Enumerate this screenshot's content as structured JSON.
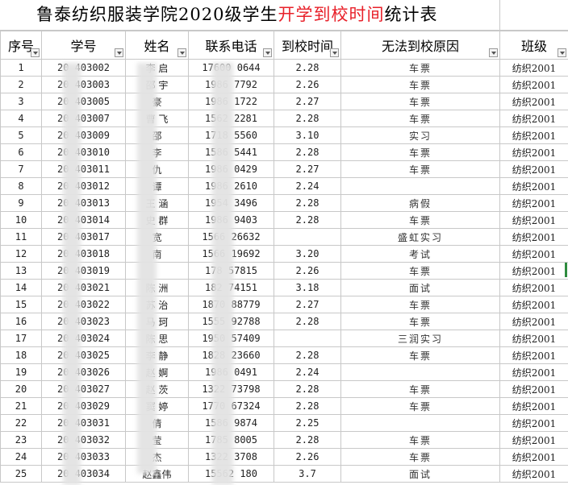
{
  "title": {
    "prefix": "鲁泰纺织服装学院2020级学生",
    "highlight": "开学到校时间",
    "suffix": "统计表"
  },
  "headers": [
    "序号",
    "学号",
    "姓名",
    "联系电话",
    "到校时间",
    "无法到校原因",
    "班级"
  ],
  "rows": [
    [
      "1",
      "20  403002",
      "李  启",
      "17600  0644",
      "2.28",
      "车票",
      "纺织2001"
    ],
    [
      "2",
      "20  403003",
      "邵  宇",
      "1986  7792",
      "2.26",
      "车票",
      "纺织2001"
    ],
    [
      "3",
      "20  403005",
      "  豪",
      "1986  1722",
      "2.27",
      "车票",
      "纺织2001"
    ],
    [
      "4",
      "20  403007",
      "曹  飞",
      "1562  2281",
      "2.28",
      "车票",
      "纺织2001"
    ],
    [
      "5",
      "20  403009",
      "邵  ",
      "1718  5560",
      "3.10",
      "实习",
      "纺织2001"
    ],
    [
      "6",
      "20  403010",
      "李  ",
      "1586  5441",
      "2.28",
      "车票",
      "纺织2001"
    ],
    [
      "7",
      "20  403011",
      "仇  ",
      "1986  0429",
      "2.27",
      "车票",
      "纺织2001"
    ],
    [
      "8",
      "20  403012",
      "谭  ",
      "1986  2610",
      "2.24",
      "",
      "纺织2001"
    ],
    [
      "9",
      "20  403013",
      "王  涵",
      "1954  3496",
      "2.28",
      "病假",
      "纺织2001"
    ],
    [
      "10",
      "20  403014",
      "史  群",
      "1986  9403",
      "2.28",
      "车票",
      "纺织2001"
    ],
    [
      "11",
      "20  403017",
      "  宽",
      "1566  26632",
      "",
      "盛虹实习",
      "纺织2001"
    ],
    [
      "12",
      "20  403018",
      "  南",
      "1566  19692",
      "3.20",
      "考试",
      "纺织2001"
    ],
    [
      "13",
      "20  403019",
      "  ",
      "178  57815",
      "2.26",
      "车票",
      "纺织2001"
    ],
    [
      "14",
      "20  403021",
      "陈  洲",
      "182  74151",
      "3.18",
      "面试",
      "纺织2001"
    ],
    [
      "15",
      "20  403022",
      "苏  治",
      "1870  88779",
      "2.27",
      "车票",
      "纺织2001"
    ],
    [
      "16",
      "20  403023",
      "马  珂",
      "1555  92788",
      "2.28",
      "车票",
      "纺织2001"
    ],
    [
      "17",
      "20  403024",
      "陈  思",
      "1950  57409",
      "",
      "三润实习",
      "纺织2001"
    ],
    [
      "18",
      "20  403025",
      "李  静",
      "1828  23660",
      "2.28",
      "车票",
      "纺织2001"
    ],
    [
      "19",
      "20  403026",
      "赵  婀",
      "1986  0491",
      "2.24",
      "",
      "纺织2001"
    ],
    [
      "20",
      "20  403027",
      "赵  茨",
      "1322  73798",
      "2.28",
      "车票",
      "纺织2001"
    ],
    [
      "21",
      "20  403029",
      "窦  婷",
      "1770  67324",
      "2.28",
      "车票",
      "纺织2001"
    ],
    [
      "22",
      "20  403031",
      "  倩",
      "1586  9874",
      "2.25",
      "",
      "纺织2001"
    ],
    [
      "23",
      "20  403032",
      "  莹",
      "1785  8005",
      "2.28",
      "车票",
      "纺织2001"
    ],
    [
      "24",
      "20  403033",
      "  杰",
      "1322  3708",
      "2.26",
      "车票",
      "纺织2001"
    ],
    [
      "25",
      "20  403034",
      "赵鑫伟",
      "15562  180",
      "3.7",
      "面试",
      "纺织2001"
    ]
  ],
  "colors": {
    "grid": "#c8c8c8",
    "title_highlight": "#e8212a",
    "selection": "#2e8b3e"
  }
}
